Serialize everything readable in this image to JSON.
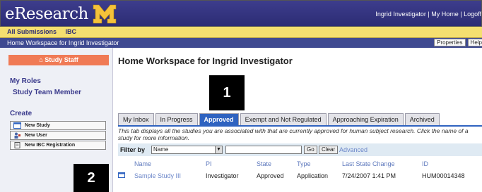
{
  "header": {
    "logo_text": "eResearch",
    "user_name": "Ingrid Investigator",
    "separator": "|",
    "home_link": "My Home",
    "logoff_link": "Logoff"
  },
  "menubar": {
    "items": [
      "All Submissions",
      "IBC"
    ]
  },
  "breadcrumb": {
    "text": "Home Workspace for Ingrid Investigator",
    "buttons": [
      "Properties",
      "Help"
    ]
  },
  "sidebar": {
    "study_staff_label": "Study Staff",
    "roles_title": "My Roles",
    "role": "Study Team Member",
    "create_title": "Create",
    "create_buttons": [
      "New Study",
      "New User",
      "New IBC Registration"
    ]
  },
  "main": {
    "title": "Home Workspace for Ingrid Investigator",
    "tabs": [
      "My Inbox",
      "In Progress",
      "Approved",
      "Exempt and Not Regulated",
      "Approaching Expiration",
      "Archived"
    ],
    "active_tab": "Approved",
    "description": "This tab displays all the studies you are associated with that are currently approved for human subject research. Click the name of a study for more information.",
    "filter": {
      "label": "Filter by",
      "selected": "Name",
      "go": "Go",
      "clear": "Clear",
      "advanced": "Advanced"
    },
    "table": {
      "headers": [
        "Name",
        "PI",
        "State",
        "Type",
        "Last State Change",
        "ID"
      ],
      "rows": [
        [
          "Sample Study III",
          "Investigator",
          "Approved",
          "Application",
          "7/24/2007 1:41 PM",
          "HUM00014348"
        ]
      ]
    }
  },
  "callouts": [
    "1",
    "2"
  ],
  "colors": {
    "header_bg": "#2c2c74",
    "menubar_bg": "#f4df70",
    "active_tab": "#2f63c0",
    "study_staff_btn": "#f07a55",
    "link": "#6b86c9"
  }
}
